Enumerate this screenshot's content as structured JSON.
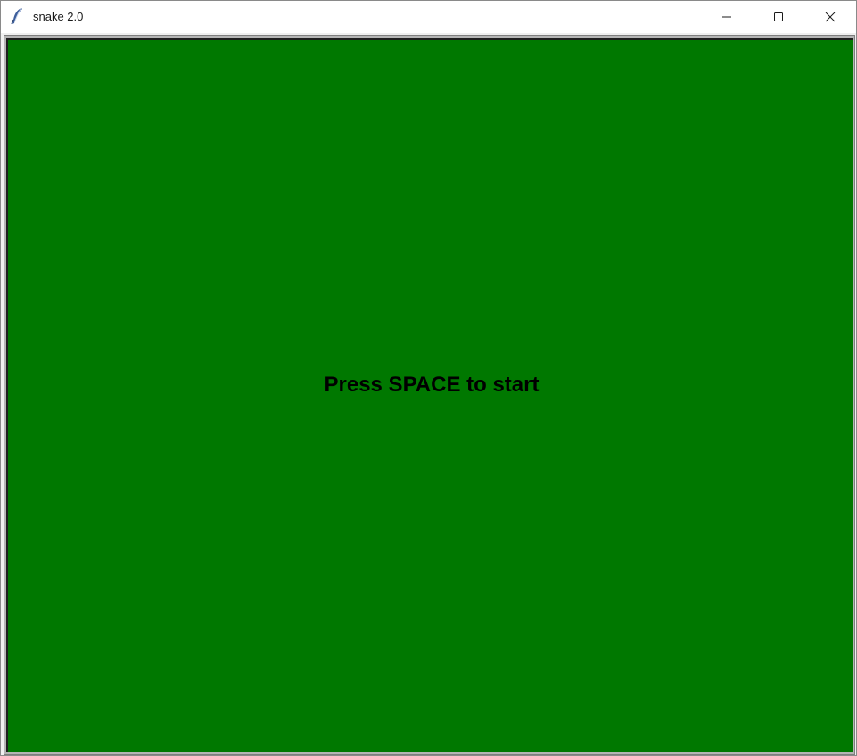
{
  "window": {
    "title": "snake 2.0",
    "icon": "feather-icon",
    "controls": [
      "minimize-icon",
      "maximize-icon",
      "close-icon"
    ]
  },
  "game": {
    "message": "Press SPACE to start",
    "background_color": "#007800",
    "text_color": "#000000"
  }
}
